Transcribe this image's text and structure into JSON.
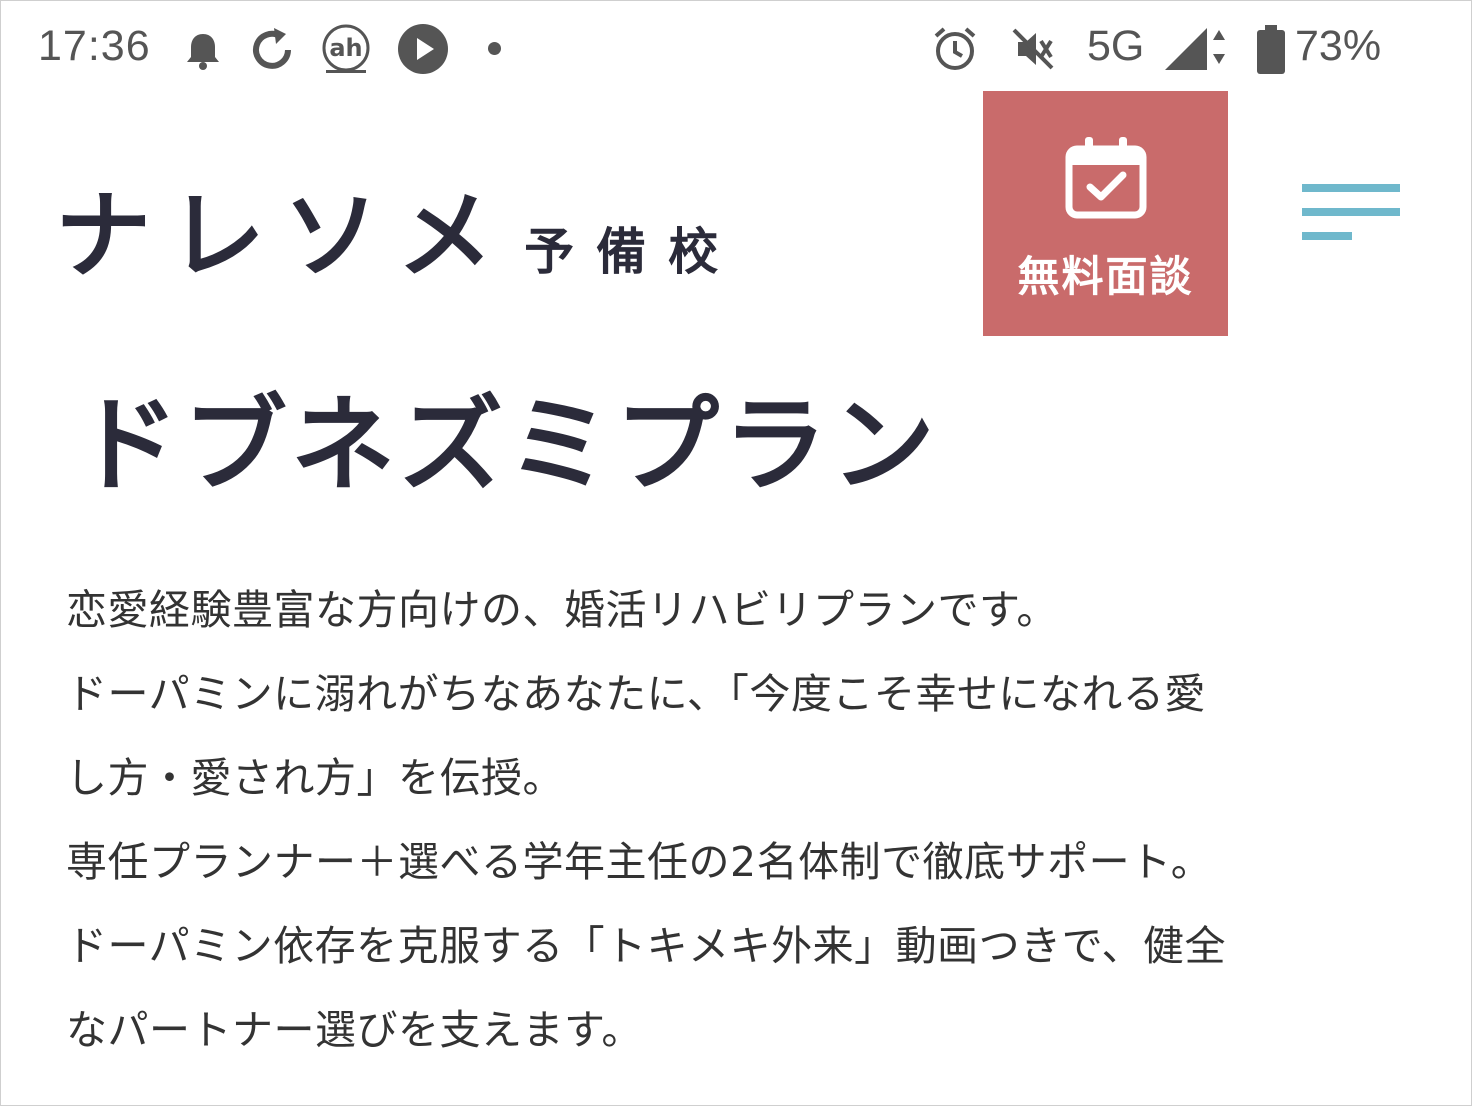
{
  "status_bar": {
    "time": "17:36",
    "left_icons": [
      "bell-icon",
      "refresh-icon",
      "ah-app-icon",
      "play-icon",
      "notification-dot"
    ],
    "right_icons": [
      "alarm-icon",
      "vibrate-off-icon",
      "signal-icon",
      "battery-icon"
    ],
    "network": "5G",
    "battery": "73%"
  },
  "header": {
    "logo_main": "ナレソメ",
    "logo_sub": "予備校",
    "consult_button": {
      "label": "無料面談",
      "icon": "calendar-check-icon",
      "color": "#c96b6b"
    },
    "menu_icon": "hamburger-menu-icon",
    "menu_color": "#6fb8cc"
  },
  "main": {
    "title": "ドブネズミプラン",
    "description_lines": [
      "恋愛経験豊富な方向けの、婚活リハビリプランです。",
      "ドーパミンに溺れがちなあなたに、「今度こそ幸せになれる愛",
      "し方・愛され方」を伝授。",
      "専任プランナー＋選べる学年主任の2名体制で徹底サポート。",
      "ドーパミン依存を克服する「トキメキ外来」動画つきで、健全",
      "なパートナー選びを支えます。"
    ]
  }
}
